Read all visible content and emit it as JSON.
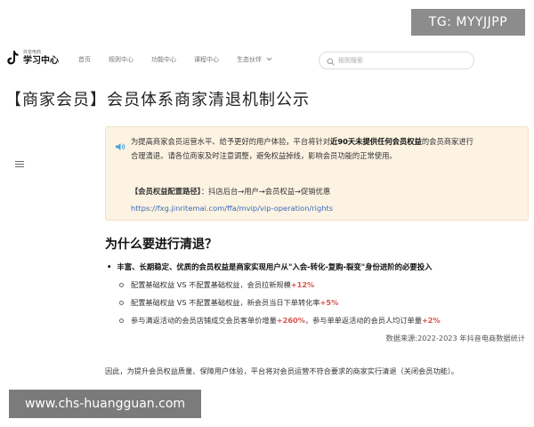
{
  "watermarks": {
    "top": "TG: MYYJJPP",
    "bottom": "www.chs-huangguan.com"
  },
  "logo": {
    "small": "抖音电商",
    "big": "学习中心"
  },
  "nav": {
    "items": [
      "首页",
      "规则中心",
      "功能中心",
      "课程中心",
      "生态伙伴"
    ],
    "search_placeholder": "规则搜索"
  },
  "page": {
    "title": "【商家会员】会员体系商家清退机制公示"
  },
  "notice": {
    "line1_pre": "为提高商家会员运营水平、给予更好的用户体验，平台将针对",
    "line1_bold": "近90天未提供任何会员权益",
    "line1_post": "的会员商家进行",
    "line2": "合理清退。请各位商家及时注意调整，避免权益掉线，影响会员功能的正常使用。",
    "path_label": "【会员权益配置路径】",
    "path_text": "：抖店后台→用户→会员权益→促销优惠",
    "link": "https://fxg.jinritemai.com/ffa/mvip/vip-operation/rights"
  },
  "section": {
    "title": "为什么要进行清退？",
    "main_bullet": "丰富、长期稳定、优质的会员权益是商家实现用户从\"入会-转化-复购-裂变\"身份进阶的必要投入",
    "items": [
      {
        "text": "配置基础权益 VS  不配置基础权益，会员拉新规模",
        "highlight": "+12%"
      },
      {
        "text": "配置基础权益 VS  不配置基础权益，新会员当日下单转化率",
        "highlight": "+5%"
      },
      {
        "text": "参与满返活动的会员店铺成交会员客单价增量",
        "highlight": "+260%",
        "text2": "，参与单单返活动的会员人均订单量",
        "highlight2": "+2%"
      }
    ],
    "source": "数据来源:2022-2023 年抖音电商数据统计",
    "conclusion": "因此，为提升会员权益质量、保障用户体验，平台将对会员运营不符合要求的商家实行清退（关闭会员功能）。"
  }
}
